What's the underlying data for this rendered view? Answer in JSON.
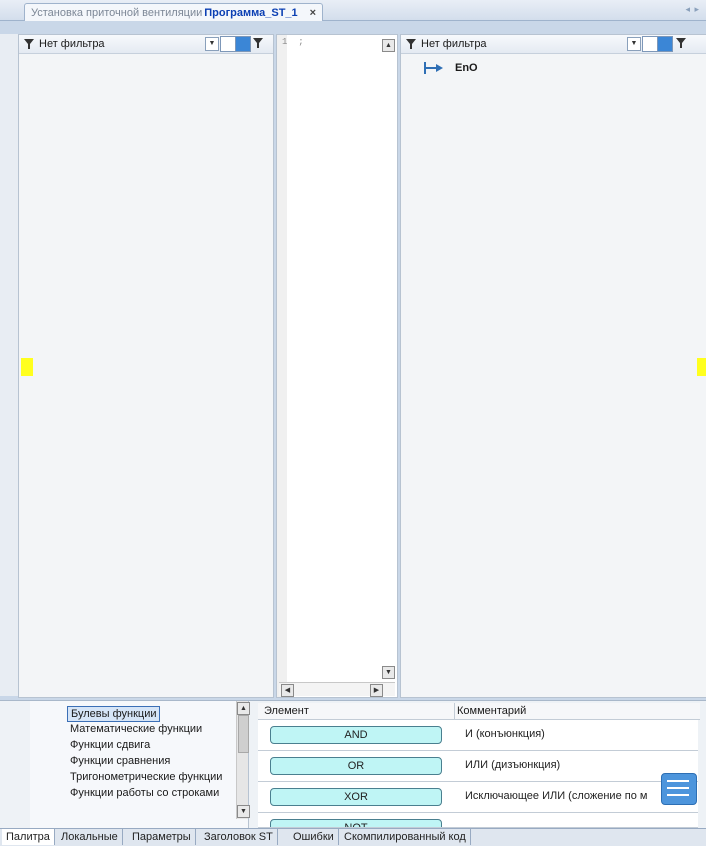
{
  "doc_tab": {
    "prefix": "Установка приточной вентиляции",
    "name": "Программа_ST_1",
    "close": "×"
  },
  "tab_scroll": "◂ ▸",
  "left_filter": {
    "label": "Нет фильтра"
  },
  "right_filter": {
    "label": "Нет фильтра"
  },
  "editor": {
    "line_text": "1  ;"
  },
  "outputs": [
    {
      "label": "EnO"
    }
  ],
  "categories": [
    {
      "label": "Булевы функции",
      "selected": true
    },
    {
      "label": "Математические функции"
    },
    {
      "label": "Функции сдвига"
    },
    {
      "label": "Функции сравнения"
    },
    {
      "label": "Тригонометрические функции"
    },
    {
      "label": "Функции работы со строками"
    }
  ],
  "grid": {
    "col_element": "Элемент",
    "col_comment": "Комментарий",
    "rows": [
      {
        "element": "AND",
        "comment": "И (конъюнкция)"
      },
      {
        "element": "OR",
        "comment": "ИЛИ (дизъюнкция)"
      },
      {
        "element": "XOR",
        "comment": "Исключающее ИЛИ (сложение по м"
      },
      {
        "element": "NOT",
        "comment": ""
      }
    ]
  },
  "bottom_tabs": [
    {
      "label": "Палитра",
      "active": true
    },
    {
      "label": "Локальные"
    },
    {
      "label": "Параметры"
    },
    {
      "label": "Заголовок ST"
    },
    {
      "label": "Ошибки"
    },
    {
      "label": "Скомпилированный код"
    }
  ],
  "colors": {
    "accent": "#0b3fb3",
    "highlight": "#ffff1e",
    "element_fill": "#bff5f5"
  }
}
